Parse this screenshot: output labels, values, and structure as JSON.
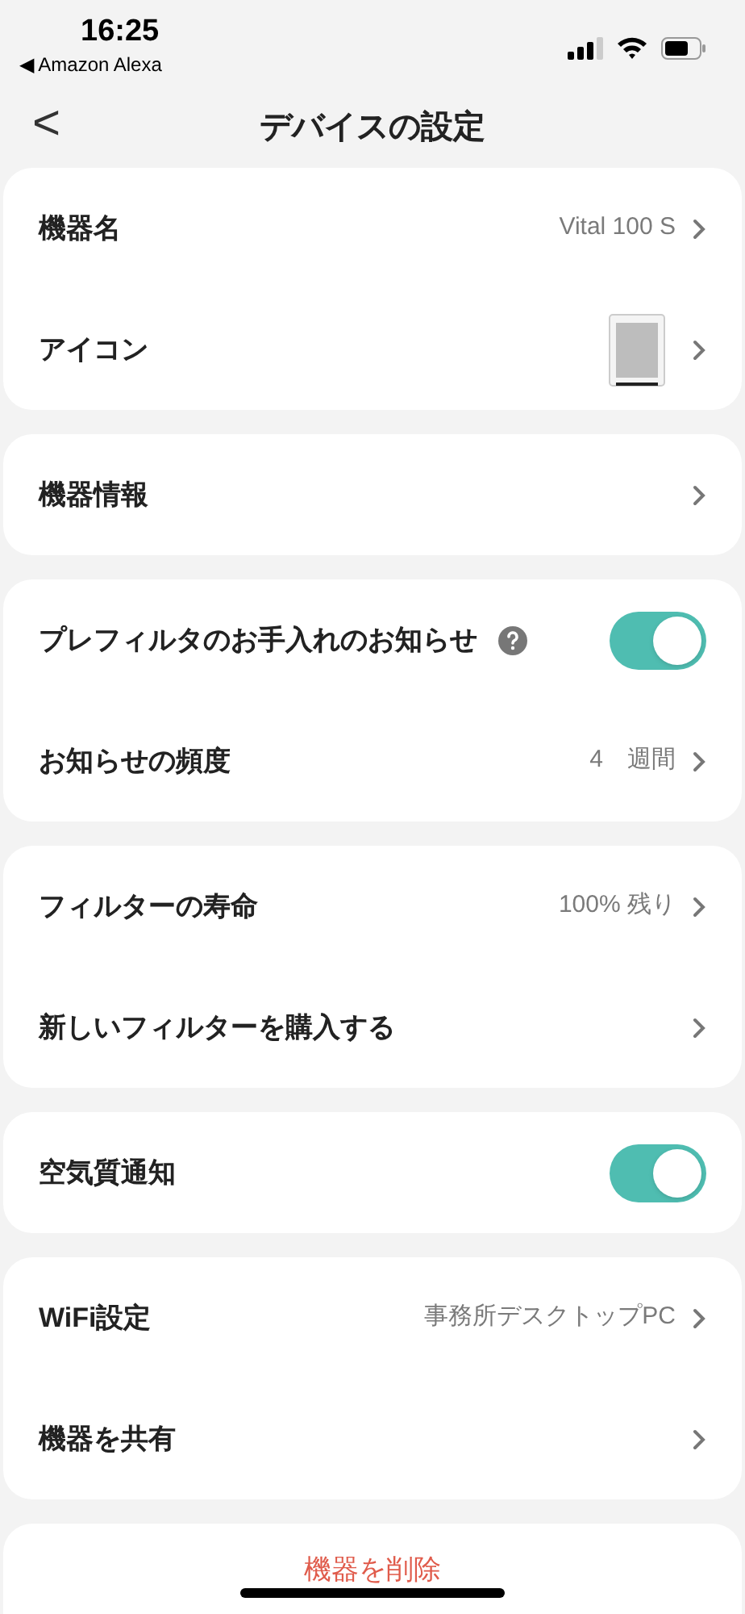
{
  "status_bar": {
    "time": "16:25",
    "back_app": "◀ Amazon Alexa"
  },
  "header": {
    "back": "<",
    "title": "デバイスの設定"
  },
  "groups": [
    {
      "rows": [
        {
          "kind": "link",
          "label": "機器名",
          "value": "Vital 100 S"
        },
        {
          "kind": "thumbnail",
          "label": "アイコン"
        }
      ]
    },
    {
      "rows": [
        {
          "kind": "link",
          "label": "機器情報"
        }
      ]
    },
    {
      "rows": [
        {
          "kind": "toggle",
          "label": "プレフィルタのお手入れのお知らせ",
          "help": true,
          "on": true
        },
        {
          "kind": "link",
          "label": "お知らせの頻度",
          "value": "4　週間"
        }
      ]
    },
    {
      "rows": [
        {
          "kind": "link",
          "label": "フィルターの寿命",
          "value": "100% 残り"
        },
        {
          "kind": "link",
          "label": "新しいフィルターを購入する"
        }
      ]
    },
    {
      "rows": [
        {
          "kind": "toggle",
          "label": "空気質通知",
          "on": true
        }
      ]
    },
    {
      "rows": [
        {
          "kind": "link",
          "label": "WiFi設定",
          "value": "事務所デスクトップPC"
        },
        {
          "kind": "link",
          "label": "機器を共有"
        }
      ]
    }
  ],
  "delete_button": "機器を削除"
}
